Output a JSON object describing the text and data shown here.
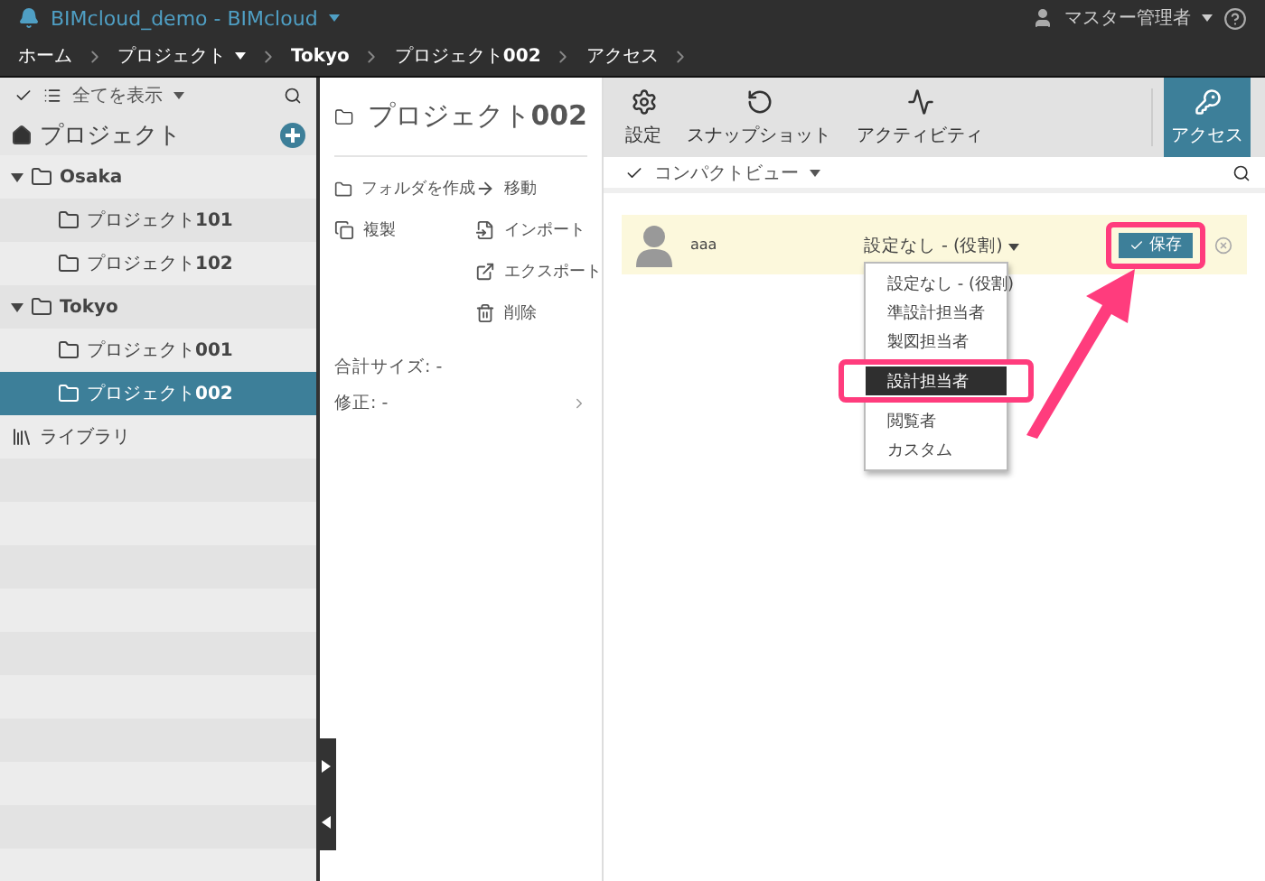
{
  "app": {
    "title": "BIMcloud_demo - BIMcloud",
    "user": "マスター管理者"
  },
  "breadcrumb": [
    {
      "label": "ホーム",
      "bold": false,
      "has_menu": false
    },
    {
      "label": "プロジェクト",
      "bold": false,
      "has_menu": true
    },
    {
      "label": "Tokyo",
      "bold": true,
      "has_menu": false
    },
    {
      "label": "プロジェクト**002**",
      "bold": false,
      "has_menu": false
    },
    {
      "label": "アクセス",
      "bold": false,
      "has_menu": false
    }
  ],
  "sidebar": {
    "filter": "全てを表示",
    "header": "プロジェクト",
    "tree": [
      {
        "label": "Osaka",
        "kind": "folder",
        "expanded": true,
        "selected": false,
        "children": [
          {
            "label": "プロジェクト**101**",
            "kind": "folder",
            "selected": false
          },
          {
            "label": "プロジェクト**102**",
            "kind": "folder",
            "selected": false
          }
        ]
      },
      {
        "label": "Tokyo",
        "kind": "folder",
        "expanded": true,
        "selected": false,
        "children": [
          {
            "label": "プロジェクト**001**",
            "kind": "folder",
            "selected": false
          },
          {
            "label": "プロジェクト**002**",
            "kind": "folder",
            "selected": true
          }
        ]
      },
      {
        "label": "ライブラリ",
        "kind": "library",
        "selected": false
      }
    ]
  },
  "details": {
    "title": "プロジェクト**002**",
    "actions_left": [
      {
        "label": "フォルダを作成",
        "kind": "folder"
      },
      {
        "label": "複製",
        "kind": "duplicate"
      }
    ],
    "actions_right": [
      {
        "label": "移動",
        "kind": "move"
      },
      {
        "label": "インポート",
        "kind": "import"
      },
      {
        "label": "エクスポート",
        "kind": "export"
      },
      {
        "label": "削除",
        "kind": "delete"
      }
    ],
    "info": [
      {
        "label": "合計サイズ: -",
        "chevron": false
      },
      {
        "label": "修正: -",
        "chevron": true
      }
    ]
  },
  "tabs": [
    {
      "label": "設定",
      "kind": "settings",
      "selected": false
    },
    {
      "label": "スナップショット",
      "kind": "snapshot",
      "selected": false
    },
    {
      "label": "アクティビティ",
      "kind": "activity",
      "selected": false
    },
    {
      "label": "アクセス",
      "kind": "key",
      "selected": true
    }
  ],
  "view": {
    "mode": "コンパクトビュー"
  },
  "access": {
    "user": "aaa",
    "role": "設定なし - (役割)",
    "save": "保存",
    "options": [
      {
        "label": "設定なし - (役割)",
        "selected": false
      },
      {
        "label": "準設計担当者",
        "selected": false
      },
      {
        "label": "製図担当者",
        "selected": false
      },
      {
        "label": "設計担当者",
        "selected": true
      },
      {
        "label": "閲覧者",
        "selected": false
      },
      {
        "label": "カスタム",
        "selected": false
      }
    ]
  }
}
